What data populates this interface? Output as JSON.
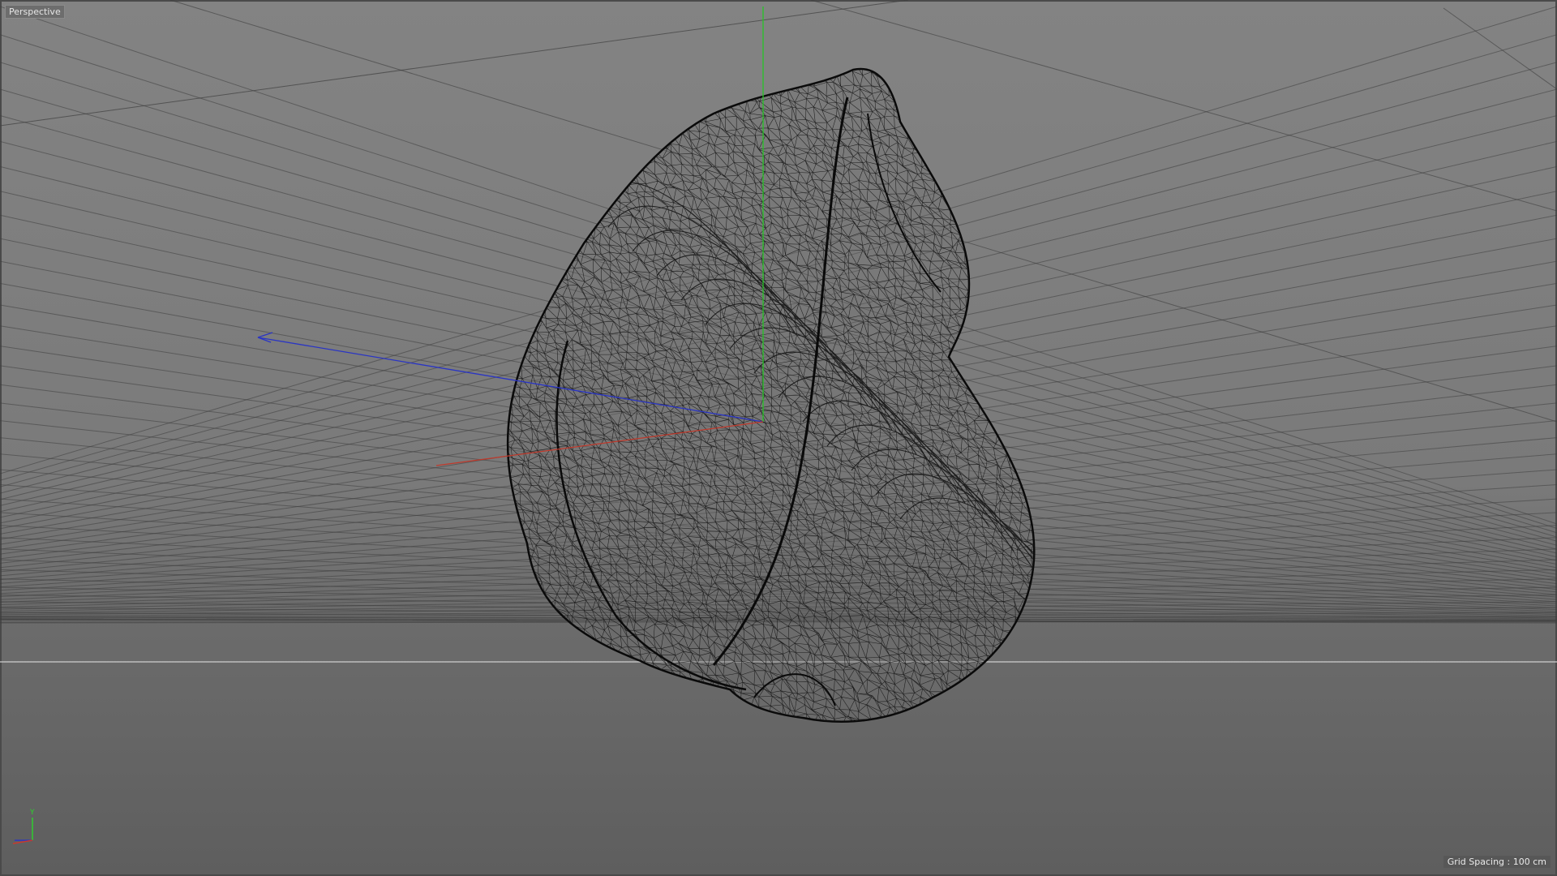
{
  "viewport": {
    "view_name": "Perspective",
    "grid_spacing_text": "Grid Spacing : 100 cm"
  },
  "axes": {
    "x_color": "#c0392b",
    "y_color": "#26c426",
    "z_color": "#2a35c4"
  },
  "gizmo": {
    "y_label": "Y",
    "icon": "axis-gizmo-icon"
  },
  "object": {
    "display_mode": "wireframe",
    "wire_color": "#111111",
    "icon": "wireframe-mesh-icon"
  }
}
